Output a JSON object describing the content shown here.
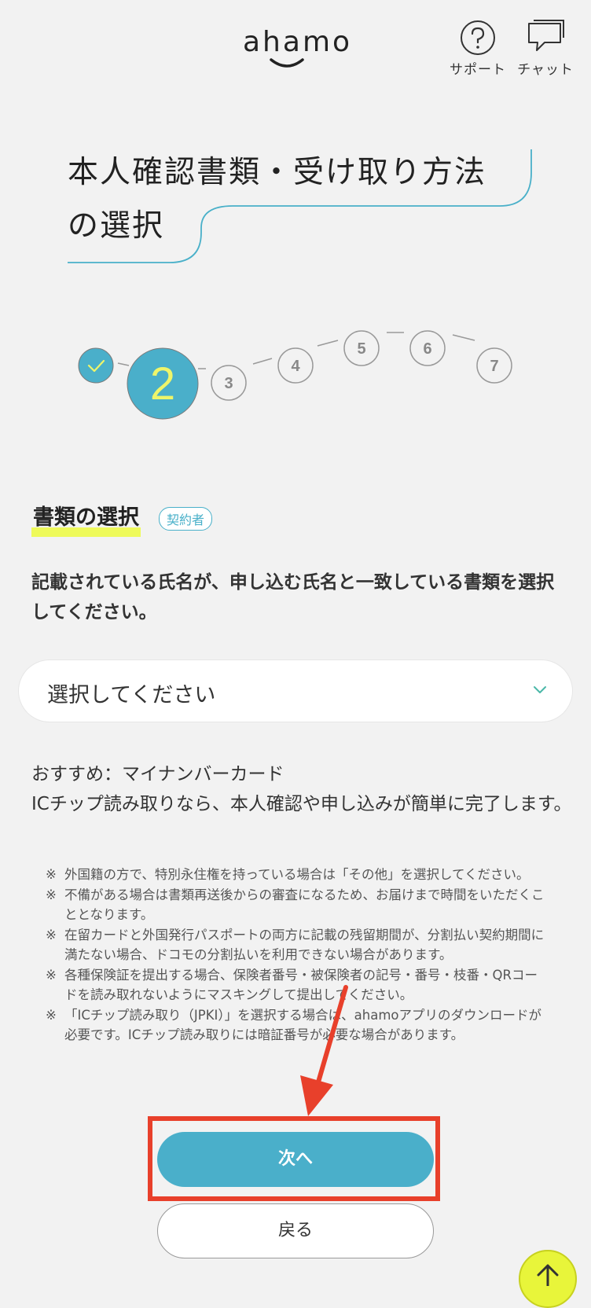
{
  "header": {
    "logo_text": "ahamo",
    "support_label": "サポート",
    "chat_label": "チャット"
  },
  "title": {
    "line1": "本人確認書類・受け取り方法",
    "line2": "の選択"
  },
  "stepper": {
    "completed_step": 1,
    "current_step": "2",
    "steps": [
      "3",
      "4",
      "5",
      "6",
      "7"
    ]
  },
  "section": {
    "heading": "書類の選択",
    "badge": "契約者"
  },
  "instruction": "記載されている氏名が、申し込む氏名と一致している書類を選択してください。",
  "select": {
    "placeholder": "選択してください"
  },
  "recommendation": {
    "line1": "おすすめ：マイナンバーカード",
    "line2": "ICチップ読み取りなら、本人確認や申し込みが簡単に完了します。"
  },
  "notes": {
    "mark": "※",
    "items": [
      "外国籍の方で、特別永住権を持っている場合は「その他」を選択してください。",
      "不備がある場合は書類再送後からの審査になるため、お届けまで時間をいただくこととなります。",
      "在留カードと外国発行パスポートの両方に記載の残留期間が、分割払い契約期間に満たない場合、ドコモの分割払いを利用できない場合があります。",
      "各種保険証を提出する場合、保険者番号・被保険者の記号・番号・枝番・QRコードを読み取れないようにマスキングして提出してください。",
      "「ICチップ読み取り（JPKI）」を選択する場合は、ahamoアプリのダウンロードが必要です。ICチップ読み取りには暗証番号が必要な場合があります。"
    ]
  },
  "buttons": {
    "next": "次へ",
    "back": "戻る"
  },
  "colors": {
    "accent": "#4aafca",
    "highlight_yellow": "#eefa5a",
    "annotation_red": "#e8402b"
  }
}
